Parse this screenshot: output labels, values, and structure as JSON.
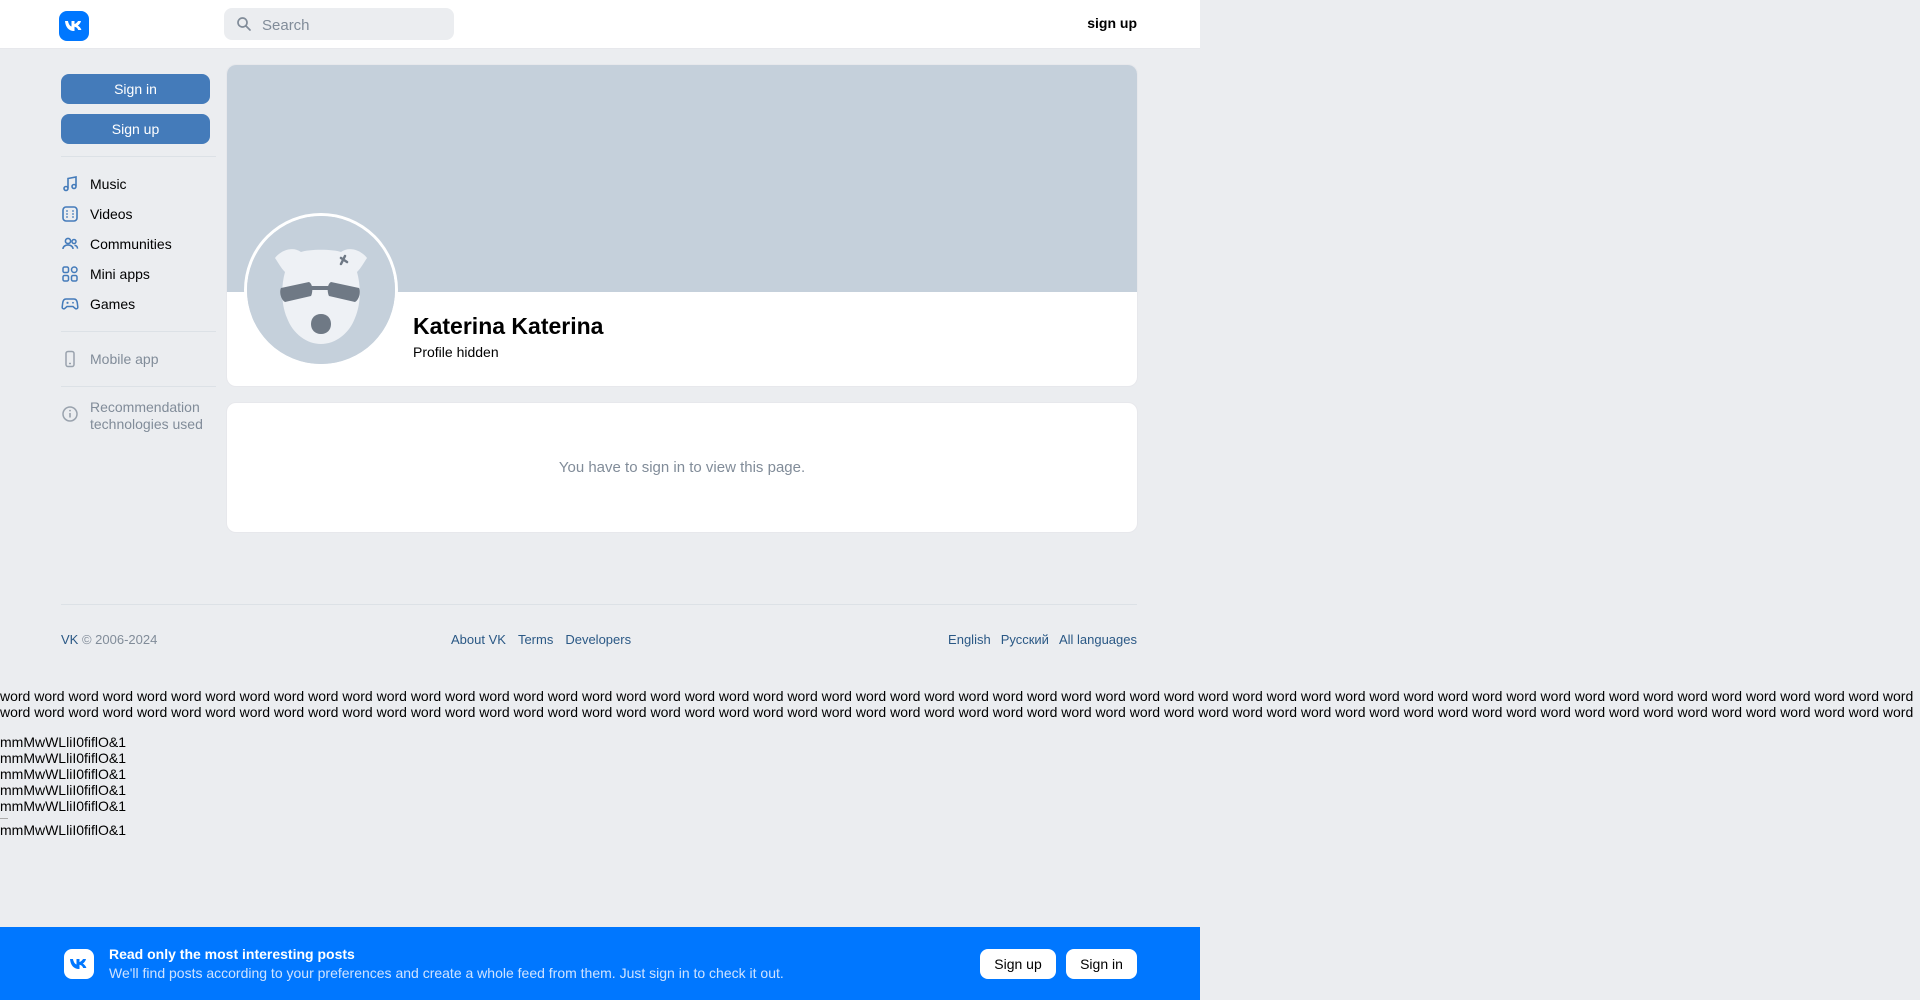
{
  "header": {
    "logo_icon": "vk-logo-icon",
    "search_placeholder": "Search",
    "signup_label": "sign up"
  },
  "sidebar": {
    "signin_label": "Sign in",
    "signup_label": "Sign up",
    "items": [
      {
        "label": "Music",
        "icon": "music-note-icon"
      },
      {
        "label": "Videos",
        "icon": "video-icon"
      },
      {
        "label": "Communities",
        "icon": "users-icon"
      },
      {
        "label": "Mini apps",
        "icon": "grid-icon"
      },
      {
        "label": "Games",
        "icon": "gamepad-icon"
      }
    ],
    "mobile_app_label": "Mobile app",
    "reco_label_line1": "Recommendation",
    "reco_label_line2": "technologies used"
  },
  "profile": {
    "name": "Katerina Katerina",
    "status": "Profile hidden",
    "cover_color": "#c5d0db"
  },
  "message": {
    "text": "You have to sign in to view this page."
  },
  "footer": {
    "vk": "VK",
    "copyright": " © 2006-2024",
    "links": [
      "About VK",
      "Terms",
      "Developers"
    ],
    "languages": [
      "English",
      "Русский",
      "All languages"
    ]
  },
  "raw": {
    "words": "word word word word word word word word word word word word word word word word word word word word word word word word word word word word word word word word word word word word word word word word word word word word word word word word word word word word word word word word word word word word word word word word word word word word word word word word word word word word word word word word word word word word word word word word word word word word word word word word word word word word word word word word word word word word word word word word word word word word word word word word word word word word word word word word word word word word word word",
    "lines": [
      "mmMwWLliI0fiflO&1",
      "mmMwWLliI0fiflO&1",
      "mmMwWLliI0fiflO&1",
      "mmMwWLliI0fiflO&1",
      "mmMwWLliI0fiflO&1"
    ],
    "last_line": "mmMwWLliI0fiflO&1"
  },
  "banner": {
    "title": "Read only the most interesting posts",
    "text": "We'll find posts according to your preferences and create a whole feed from them. Just sign in to check it out.",
    "signup_label": "Sign up",
    "signin_label": "Sign in",
    "color": "#0077ff"
  },
  "colors": {
    "accent": "#447bba",
    "link": "#2a5885",
    "muted": "#818c99",
    "page_bg": "#ebedf0"
  }
}
